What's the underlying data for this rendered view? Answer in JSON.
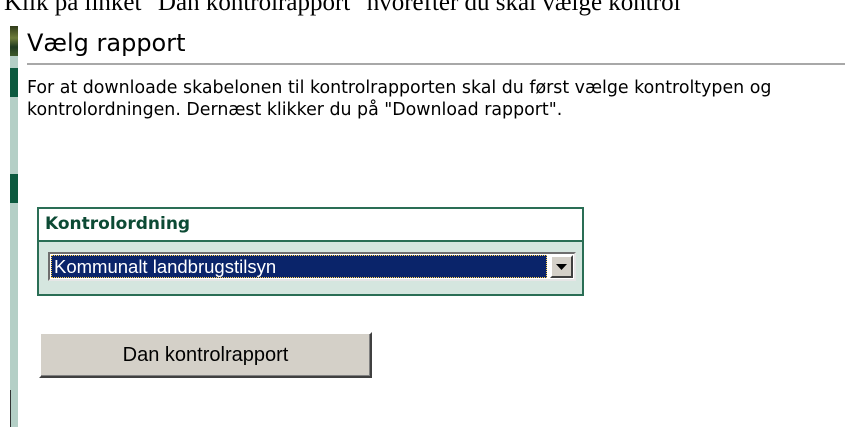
{
  "doc_text": "Klik på linket \"Dan kontrolrapport\" hvorefter du skal vælge kontrol",
  "heading": "Vælg rapport",
  "intro": "For at downloade skabelonen til kontrolrapporten skal du først vælge kontroltypen og kontrolordningen. Dernæst klikker du på \"Download rapport\".",
  "panel": {
    "title": "Kontrolordning",
    "select_value": "Kommunalt landbrugstilsyn",
    "arrow_icon": "chevron-down-icon"
  },
  "button_label": "Dan kontrolrapport",
  "colors": {
    "accent": "#0c5a3f",
    "panel_border": "#2a6e55",
    "panel_body": "#d5e6df",
    "selection": "#0a246a"
  }
}
